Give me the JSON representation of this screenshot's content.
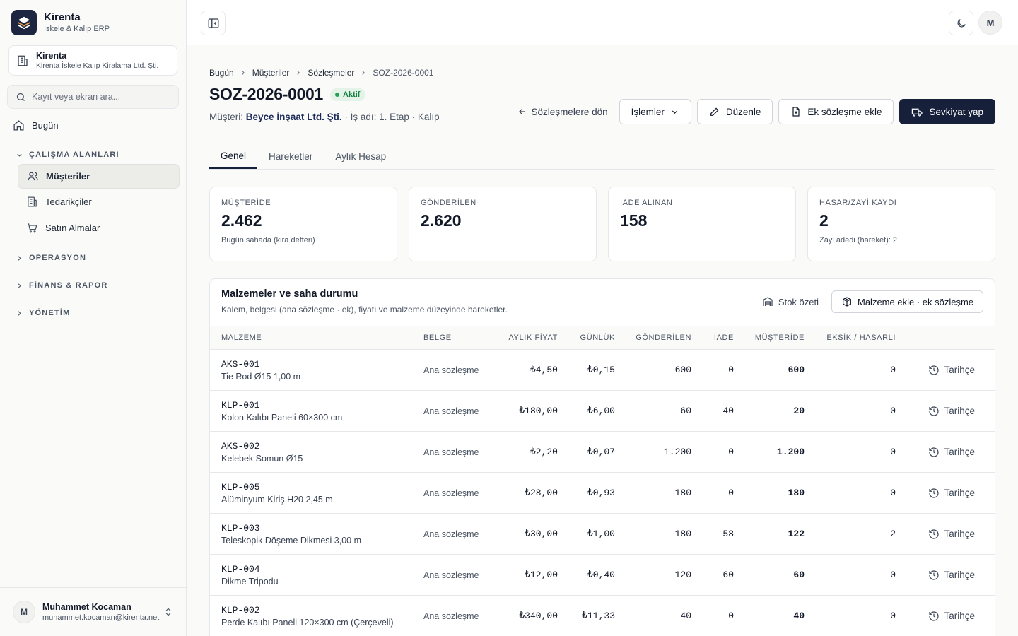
{
  "brand": {
    "name": "Kirenta",
    "subtitle": "İskele & Kalıp ERP"
  },
  "company": {
    "name": "Kirenta",
    "full_name": "Kirenta İskele Kalıp Kiralama Ltd. Şti."
  },
  "search": {
    "placeholder": "Kayıt veya ekran ara..."
  },
  "nav": {
    "today": "Bugün",
    "sections": {
      "workspaces": "ÇALIŞMA ALANLARI",
      "operations": "OPERASYON",
      "finance": "FİNANS & RAPOR",
      "admin": "YÖNETİM"
    },
    "items": [
      "Müşteriler",
      "Tedarikçiler",
      "Satın Almalar"
    ]
  },
  "user": {
    "initial": "M",
    "name": "Muhammet Kocaman",
    "email": "muhammet.kocaman@kirenta.net"
  },
  "topbar": {
    "avatar": "M"
  },
  "breadcrumb": [
    "Bugün",
    "Müşteriler",
    "Sözleşmeler",
    "SOZ-2026-0001"
  ],
  "contract": {
    "title": "SOZ-2026-0001",
    "status": "Aktif",
    "customer_label": "Müşteri:",
    "customer": "Beyce İnşaat Ltd. Şti.",
    "job": "· İş adı: 1. Etap · Kalıp"
  },
  "actions": {
    "back": "Sözleşmelere dön",
    "operations": "İşlemler",
    "edit": "Düzenle",
    "add_addendum": "Ek sözleşme ekle",
    "ship": "Sevkiyat yap"
  },
  "tabs": [
    "Genel",
    "Hareketler",
    "Aylık Hesap"
  ],
  "cards": [
    {
      "label": "MÜŞTERİDE",
      "value": "2.462",
      "sub": "Bugün sahada (kira defteri)"
    },
    {
      "label": "GÖNDERİLEN",
      "value": "2.620",
      "sub": ""
    },
    {
      "label": "İADE ALINAN",
      "value": "158",
      "sub": ""
    },
    {
      "label": "HASAR/ZAYİ KAYDI",
      "value": "2",
      "sub": "Zayi adedi (hareket): 2"
    }
  ],
  "panel": {
    "title": "Malzemeler ve saha durumu",
    "subtitle": "Kalem, belgesi (ana sözleşme · ek), fiyatı ve malzeme düzeyinde hareketler.",
    "stock_summary": "Stok özeti",
    "add_material": "Malzeme ekle · ek sözleşme"
  },
  "table": {
    "columns": [
      "MALZEME",
      "BELGE",
      "AYLIK FİYAT",
      "GÜNLÜK",
      "GÖNDERİLEN",
      "İADE",
      "MÜŞTERİDE",
      "EKSİK / HASARLI"
    ],
    "history_label": "Tarihçe",
    "rows": [
      {
        "code": "AKS-001",
        "name": "Tie Rod Ø15 1,00 m",
        "doc": "Ana sözleşme",
        "monthly": "₺4,50",
        "daily": "₺0,15",
        "sent": "600",
        "returned": "0",
        "at_customer": "600",
        "missing": "0"
      },
      {
        "code": "KLP-001",
        "name": "Kolon Kalıbı Paneli 60×300 cm",
        "doc": "Ana sözleşme",
        "monthly": "₺180,00",
        "daily": "₺6,00",
        "sent": "60",
        "returned": "40",
        "at_customer": "20",
        "missing": "0"
      },
      {
        "code": "AKS-002",
        "name": "Kelebek Somun Ø15",
        "doc": "Ana sözleşme",
        "monthly": "₺2,20",
        "daily": "₺0,07",
        "sent": "1.200",
        "returned": "0",
        "at_customer": "1.200",
        "missing": "0"
      },
      {
        "code": "KLP-005",
        "name": "Alüminyum Kiriş H20 2,45 m",
        "doc": "Ana sözleşme",
        "monthly": "₺28,00",
        "daily": "₺0,93",
        "sent": "180",
        "returned": "0",
        "at_customer": "180",
        "missing": "0"
      },
      {
        "code": "KLP-003",
        "name": "Teleskopik Döşeme Dikmesi 3,00 m",
        "doc": "Ana sözleşme",
        "monthly": "₺30,00",
        "daily": "₺1,00",
        "sent": "180",
        "returned": "58",
        "at_customer": "122",
        "missing": "2"
      },
      {
        "code": "KLP-004",
        "name": "Dikme Tripodu",
        "doc": "Ana sözleşme",
        "monthly": "₺12,00",
        "daily": "₺0,40",
        "sent": "120",
        "returned": "60",
        "at_customer": "60",
        "missing": "0"
      },
      {
        "code": "KLP-002",
        "name": "Perde Kalıbı Paneli 120×300 cm (Çerçeveli)",
        "doc": "Ana sözleşme",
        "monthly": "₺340,00",
        "daily": "₺11,33",
        "sent": "40",
        "returned": "0",
        "at_customer": "40",
        "missing": "0"
      }
    ]
  }
}
